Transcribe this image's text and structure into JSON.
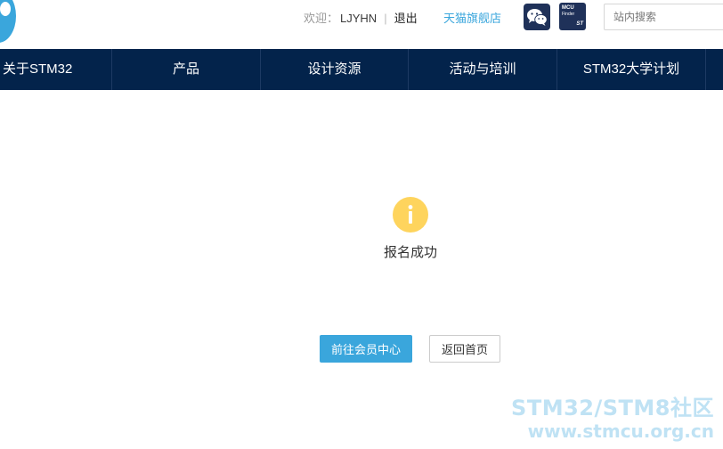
{
  "header": {
    "welcome_label": "欢迎：",
    "username": "LJYHN",
    "separator": "|",
    "logout": "退出",
    "tmall_link": "天猫旗舰店",
    "mcu_finder": {
      "line1": "MCU",
      "line2": "Finder",
      "brand": "ST"
    },
    "search": {
      "placeholder": "站内搜索"
    }
  },
  "nav": {
    "items": [
      {
        "label": "关于STM32"
      },
      {
        "label": "产品"
      },
      {
        "label": "设计资源"
      },
      {
        "label": "活动与培训"
      },
      {
        "label": "STM32大学计划"
      }
    ]
  },
  "main": {
    "status_icon": "info-icon",
    "message": "报名成功",
    "primary_button": "前往会员中心",
    "secondary_button": "返回首页"
  },
  "watermark": {
    "line1": "STM32/STM8社区",
    "line2": "www.stmcu.org.cn"
  },
  "colors": {
    "nav_bg": "#03234b",
    "accent": "#3aa6dc",
    "info_icon": "#fed45d",
    "icon_bg": "#1f3159"
  }
}
